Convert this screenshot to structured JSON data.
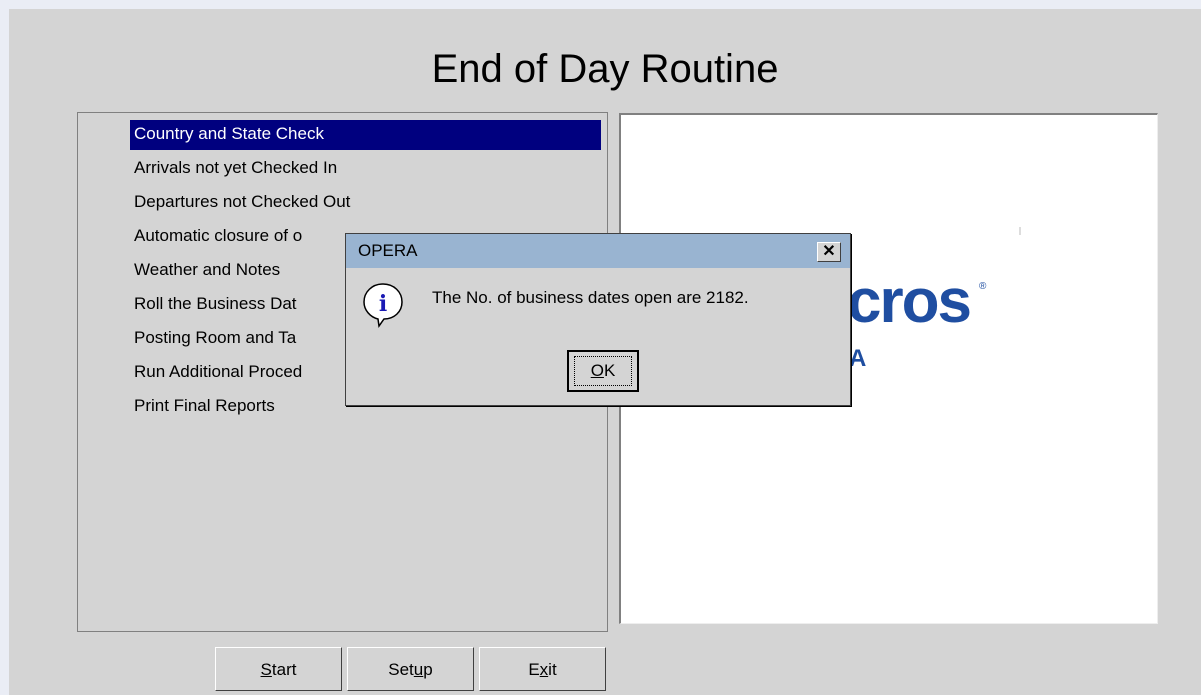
{
  "window": {
    "title": "End of Day Routine"
  },
  "routine_list": {
    "selected_index": 0,
    "items": [
      {
        "label": "Country and State Check"
      },
      {
        "label": "Arrivals not yet Checked In"
      },
      {
        "label": "Departures not Checked Out"
      },
      {
        "label": "Automatic closure of o"
      },
      {
        "label": "Weather and Notes"
      },
      {
        "label": "Roll the Business Dat"
      },
      {
        "label": "Posting Room and Ta"
      },
      {
        "label": "Run Additional Proced"
      },
      {
        "label": "Print Final Reports"
      }
    ]
  },
  "logo": {
    "text": "cros",
    "reg": "®",
    "sub": "A",
    "color": "#1f4ea1"
  },
  "buttons": {
    "start": {
      "pre": "",
      "u": "S",
      "post": "tart"
    },
    "setup": {
      "pre": "Set",
      "u": "u",
      "post": "p"
    },
    "exit": {
      "pre": "E",
      "u": "x",
      "post": "it"
    }
  },
  "dialog": {
    "title": "OPERA",
    "close_glyph": "✕",
    "icon": "info-icon",
    "message": "The No. of business dates open are 2182.",
    "ok": {
      "u": "O",
      "post": "K"
    }
  },
  "colors": {
    "selection": "#00007f",
    "titlebar": "#99b4d1",
    "face": "#d4d4d4"
  }
}
